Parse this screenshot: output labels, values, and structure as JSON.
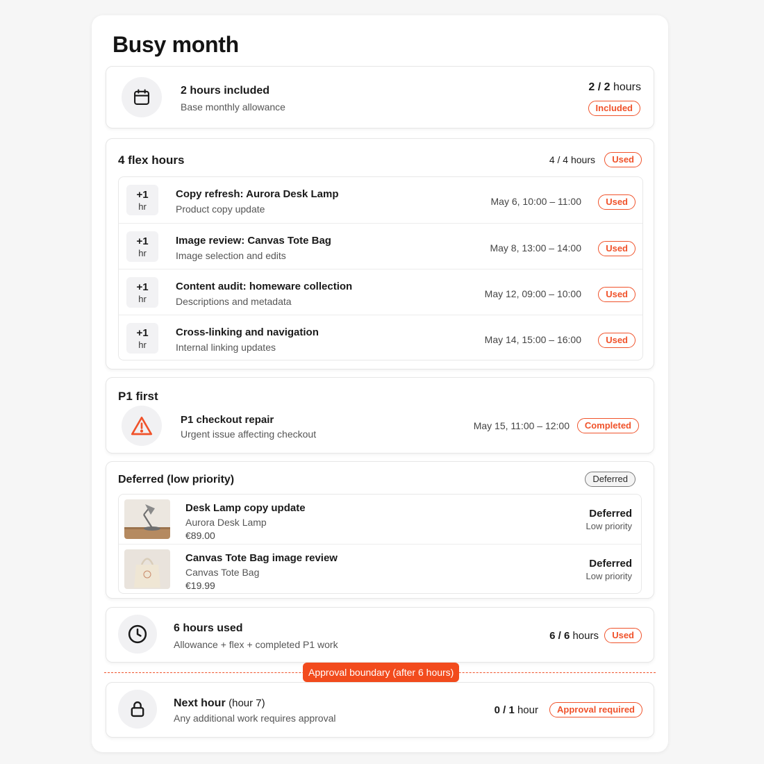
{
  "page": {
    "title": "Busy month"
  },
  "allowance": {
    "icon": "calendar-icon",
    "title": "2 hours included",
    "subtitle": "Base monthly allowance",
    "count": "2 / 2",
    "unit": "hours",
    "badge": "Included"
  },
  "flex": {
    "title": "4 flex hours",
    "summary": "4 / 4 hours",
    "badge": "Used",
    "items": [
      {
        "plus": "+1",
        "unit": "hr",
        "title": "Copy refresh: Aurora Desk Lamp",
        "subtitle": "Product copy update",
        "time": "May 6, 10:00 – 11:00",
        "badge": "Used"
      },
      {
        "plus": "+1",
        "unit": "hr",
        "title": "Image review: Canvas Tote Bag",
        "subtitle": "Image selection and edits",
        "time": "May 8, 13:00 – 14:00",
        "badge": "Used"
      },
      {
        "plus": "+1",
        "unit": "hr",
        "title": "Content audit: homeware collection",
        "subtitle": "Descriptions and metadata",
        "time": "May 12, 09:00 – 10:00",
        "badge": "Used"
      },
      {
        "plus": "+1",
        "unit": "hr",
        "title": "Cross-linking and navigation",
        "subtitle": "Internal linking updates",
        "time": "May 14, 15:00 – 16:00",
        "badge": "Used"
      }
    ]
  },
  "p1": {
    "title": "P1 first",
    "icon": "warning-icon",
    "item_title": "P1 checkout repair",
    "item_subtitle": "Urgent issue affecting checkout",
    "time": "May 15, 11:00 – 12:00",
    "badge": "Completed"
  },
  "deferred": {
    "title": "Deferred (low priority)",
    "badge": "Deferred",
    "items": [
      {
        "thumb": "desk-lamp-image",
        "title": "Desk Lamp copy update",
        "product": "Aurora Desk Lamp",
        "price": "€89.00",
        "status": "Deferred",
        "priority": "Low priority"
      },
      {
        "thumb": "tote-bag-image",
        "title": "Canvas Tote Bag image review",
        "product": "Canvas Tote Bag",
        "price": "€19.99",
        "status": "Deferred",
        "priority": "Low priority"
      }
    ]
  },
  "used": {
    "icon": "clock-icon",
    "title": "6 hours used",
    "subtitle": "Allowance + flex + completed P1 work",
    "count": "6 / 6",
    "unit": "hours",
    "badge": "Used"
  },
  "boundary": {
    "label": "Approval boundary (after 6 hours)"
  },
  "next": {
    "icon": "lock-icon",
    "title": "Next hour",
    "title_suffix": "(hour 7)",
    "subtitle": "Any additional work requires approval",
    "count": "0 / 1",
    "unit": "hour",
    "badge": "Approval required"
  },
  "colors": {
    "accent": "#f0522a",
    "boundary": "#f24b1d",
    "text": "#1a1a1a",
    "muted": "#555555"
  }
}
